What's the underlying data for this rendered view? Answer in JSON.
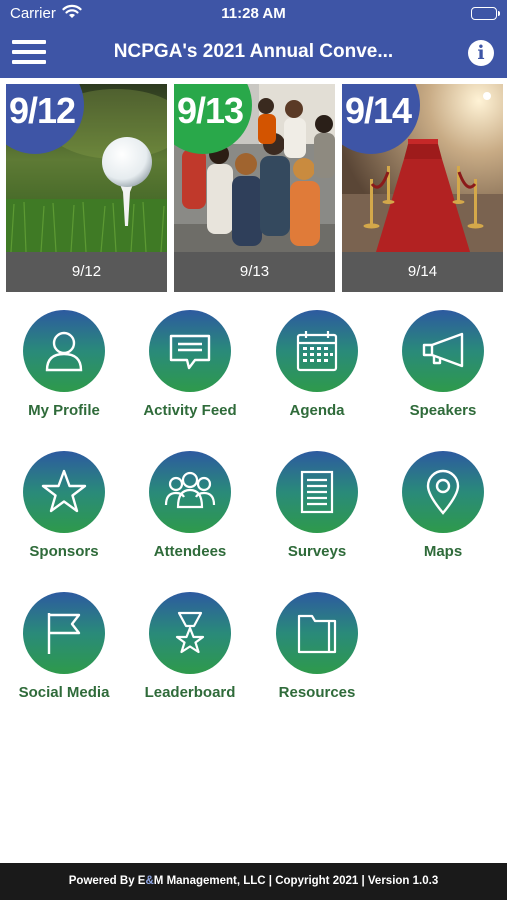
{
  "status": {
    "carrier": "Carrier",
    "time": "11:28 AM"
  },
  "header": {
    "title": "NCPGA's 2021 Annual Conve..."
  },
  "days": [
    {
      "badge": "9/12",
      "caption": "9/12",
      "badge_color": "#3e55a6"
    },
    {
      "badge": "9/13",
      "caption": "9/13",
      "badge_color": "#29a84a"
    },
    {
      "badge": "9/14",
      "caption": "9/14",
      "badge_color": "#3e55a6"
    }
  ],
  "menu": [
    {
      "label": "My Profile",
      "icon": "person-icon"
    },
    {
      "label": "Activity Feed",
      "icon": "chat-bubble-icon"
    },
    {
      "label": "Agenda",
      "icon": "calendar-icon"
    },
    {
      "label": "Speakers",
      "icon": "megaphone-icon"
    },
    {
      "label": "Sponsors",
      "icon": "star-icon"
    },
    {
      "label": "Attendees",
      "icon": "group-icon"
    },
    {
      "label": "Surveys",
      "icon": "document-icon"
    },
    {
      "label": "Maps",
      "icon": "map-pin-icon"
    },
    {
      "label": "Social Media",
      "icon": "flag-icon"
    },
    {
      "label": "Leaderboard",
      "icon": "trophy-icon"
    },
    {
      "label": "Resources",
      "icon": "folder-icon"
    }
  ],
  "footer": {
    "prefix": "Powered By ",
    "e": "E",
    "amp": "&",
    "m": "M",
    "suffix": " Management, LLC | Copyright 2021 | Version 1.0.3"
  },
  "colors": {
    "brand": "#3e55a6",
    "label_green": "#2f6b3a",
    "footer_bg": "#1a1a1a"
  }
}
